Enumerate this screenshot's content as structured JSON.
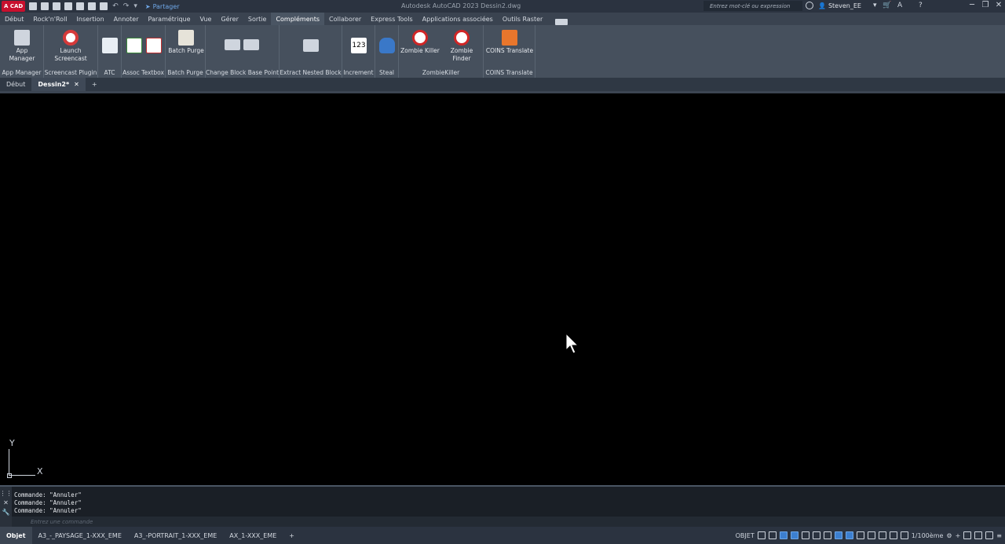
{
  "titlebar": {
    "logo": "A CAD",
    "share_label": "Partager",
    "title": "Autodesk AutoCAD 2023    Dessin2.dwg",
    "search_placeholder": "Entrez mot-clé ou expression",
    "user": "Steven_EE"
  },
  "tabs": [
    "Début",
    "Rock'n'Roll",
    "Insertion",
    "Annoter",
    "Paramétrique",
    "Vue",
    "Gérer",
    "Sortie",
    "Compléments",
    "Collaborer",
    "Express Tools",
    "Applications associées",
    "Outils Raster"
  ],
  "active_tab": "Compléments",
  "ribbon": {
    "groups": [
      {
        "label": "App Manager",
        "buttons": [
          "App Manager"
        ]
      },
      {
        "label": "Screencast Plugin",
        "buttons": [
          "Launch Screencast"
        ]
      },
      {
        "label": "ATC",
        "buttons": [
          ""
        ]
      },
      {
        "label": "Assoc Textbox",
        "buttons": [
          ""
        ]
      },
      {
        "label": "Batch Purge",
        "buttons": [
          "Batch Purge"
        ]
      },
      {
        "label": "Change Block Base Point",
        "buttons": [
          ""
        ]
      },
      {
        "label": "Extract Nested Block",
        "buttons": [
          ""
        ]
      },
      {
        "label": "Increment",
        "buttons": [
          ""
        ]
      },
      {
        "label": "Steal",
        "buttons": [
          ""
        ]
      },
      {
        "label": "ZombieKiller",
        "buttons": [
          "Zombie Killer",
          "Zombie Finder"
        ]
      },
      {
        "label": "COINS Translate",
        "buttons": [
          "COINS Translate"
        ]
      }
    ]
  },
  "doc_tabs": [
    {
      "label": "Début",
      "active": false
    },
    {
      "label": "Dessin2*",
      "active": true
    }
  ],
  "ucs": {
    "x_label": "X",
    "y_label": "Y"
  },
  "command": {
    "history": [
      "Commande: \"Annuler\"",
      "Commande: \"Annuler\"",
      "Commande: \"Annuler\""
    ],
    "placeholder": "Entrez une commande"
  },
  "layout_tabs": [
    "Objet",
    "A3_-_PAYSAGE_1-XXX_EME",
    "A3_-PORTRAIT_1-XXX_EME",
    "AX_1-XXX_EME"
  ],
  "status": {
    "model_label": "OBJET",
    "scale": "1/100ème"
  }
}
